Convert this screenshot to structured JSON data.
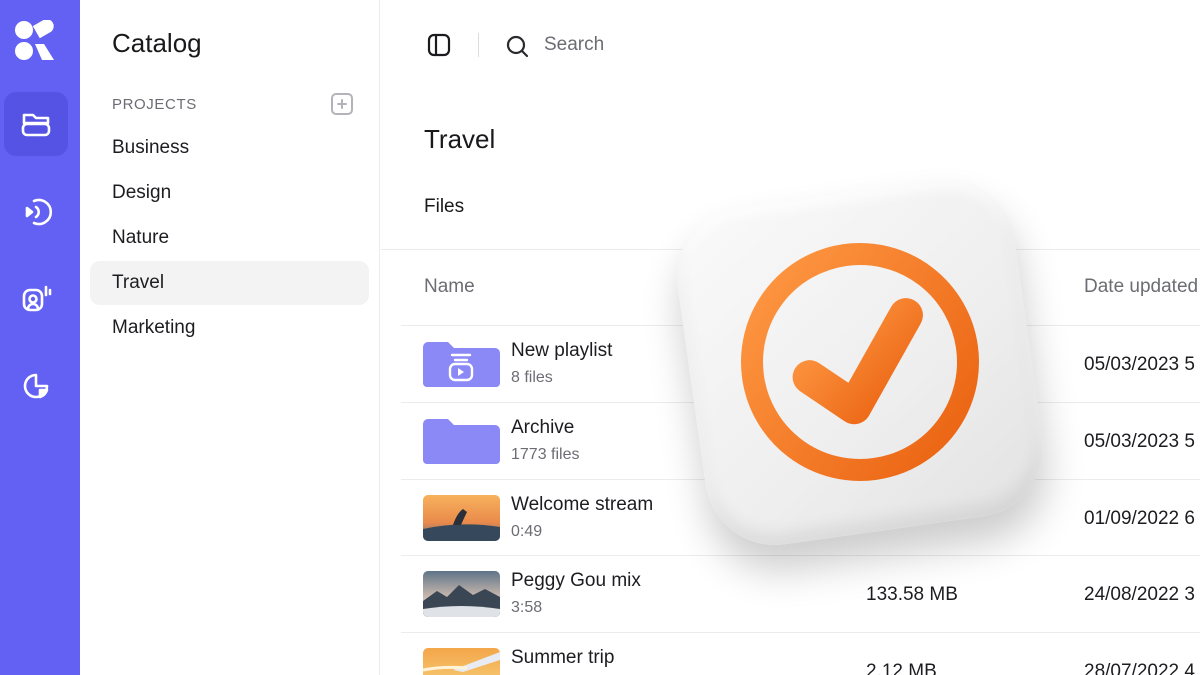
{
  "theme": {
    "rail": "#6361f4",
    "rail_active": "#5553e4",
    "folder": "#8b89f6",
    "accent_check": "#f2741a"
  },
  "rail": {
    "items": [
      "folder-stack-icon",
      "broadcast-icon",
      "mic-user-icon",
      "chart-icon"
    ]
  },
  "sidebar": {
    "title": "Catalog",
    "section_label": "PROJECTS",
    "projects": [
      "Business",
      "Design",
      "Nature",
      "Travel",
      "Marketing"
    ],
    "active_project": "Travel"
  },
  "toolbar": {
    "search_placeholder": "Search"
  },
  "main": {
    "title": "Travel",
    "tab": "Files",
    "columns": {
      "name": "Name",
      "date": "Date updated"
    },
    "rows": [
      {
        "name": "New playlist",
        "meta": "8 files",
        "size": "",
        "date": "05/03/2023 5",
        "thumb": "playlist-folder"
      },
      {
        "name": "Archive",
        "meta": "1773 files",
        "size": "",
        "date": "05/03/2023 5",
        "thumb": "folder"
      },
      {
        "name": "Welcome stream",
        "meta": "0:49",
        "size": "",
        "date": "01/09/2022 6",
        "thumb": "sunset-photo"
      },
      {
        "name": "Peggy Gou mix",
        "meta": "3:58",
        "size": "133.58 MB",
        "date": "24/08/2022 3",
        "thumb": "mountain-photo"
      },
      {
        "name": "Summer trip",
        "meta": "",
        "size": "2.12 MB",
        "date": "28/07/2022 4",
        "thumb": "plane-photo"
      }
    ]
  },
  "overlay": {
    "icon": "check-circle-icon"
  }
}
